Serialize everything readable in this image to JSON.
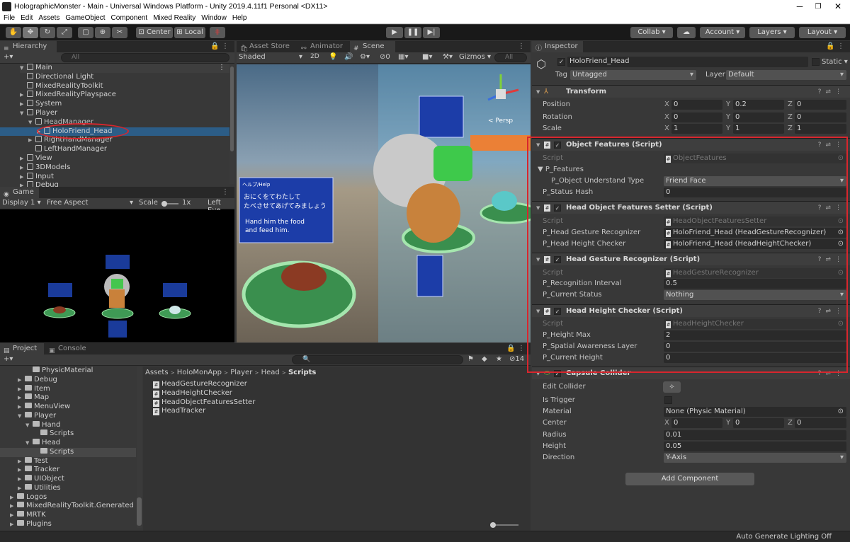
{
  "window": {
    "title": "HolographicMonster - Main - Universal Windows Platform - Unity 2019.4.11f1 Personal <DX11>"
  },
  "menu": [
    "File",
    "Edit",
    "Assets",
    "GameObject",
    "Component",
    "Mixed Reality",
    "Window",
    "Help"
  ],
  "toolbar": {
    "center_label": "Center",
    "local_label": "Local",
    "collab_label": "Collab ▾",
    "account_label": "Account",
    "layers_label": "Layers",
    "layout_label": "Layout"
  },
  "hierarchy": {
    "tab_label": "Hierarchy",
    "search_placeholder": "All",
    "scene_name": "Main",
    "items": [
      {
        "label": "Directional Light"
      },
      {
        "label": "MixedRealityToolkit"
      },
      {
        "label": "MixedRealityPlayspace"
      },
      {
        "label": "System"
      },
      {
        "label": "Player"
      },
      {
        "label": "HeadManager"
      },
      {
        "label": "HoloFriend_Head"
      },
      {
        "label": "RightHandManager"
      },
      {
        "label": "LeftHandManager"
      },
      {
        "label": "View"
      },
      {
        "label": "3DModels"
      },
      {
        "label": "Input"
      },
      {
        "label": "Debug"
      }
    ]
  },
  "game": {
    "tab_label": "Game",
    "display": "Display 1",
    "aspect": "Free Aspect",
    "scale_label": "Scale",
    "scale_value": "1x",
    "left_eye": "Left Eye"
  },
  "scene": {
    "tabs": [
      {
        "label": "Asset Store"
      },
      {
        "label": "Animator"
      },
      {
        "label": "Scene"
      }
    ],
    "shading": "Shaded",
    "mode_2d": "2D",
    "gizmos": "Gizmos",
    "search_placeholder": "All",
    "persp": "< Persp",
    "panel_title": "ヘルプ/Help",
    "panel_jp_1": "おにくをてわたして",
    "panel_jp_2": "たべさせてあげてみましょう",
    "panel_en_1": "Hand him the food",
    "panel_en_2": "and feed him."
  },
  "project": {
    "tabs": [
      {
        "label": "Project"
      },
      {
        "label": "Console"
      }
    ],
    "hidden_count": "14",
    "breadcrumb": [
      "Assets",
      "HoloMonApp",
      "Player",
      "Head",
      "Scripts"
    ],
    "tree": [
      {
        "label": "PhysicMaterial"
      },
      {
        "label": "Debug"
      },
      {
        "label": "Item"
      },
      {
        "label": "Map"
      },
      {
        "label": "MenuView"
      },
      {
        "label": "Player"
      },
      {
        "label": "Hand"
      },
      {
        "label": "Scripts"
      },
      {
        "label": "Head"
      },
      {
        "label": "Scripts"
      },
      {
        "label": "Test"
      },
      {
        "label": "Tracker"
      },
      {
        "label": "UIObject"
      },
      {
        "label": "Utilities"
      },
      {
        "label": "Logos"
      },
      {
        "label": "MixedRealityToolkit.Generated"
      },
      {
        "label": "MRTK"
      },
      {
        "label": "Plugins"
      }
    ],
    "files": [
      {
        "label": "HeadGestureRecognizer"
      },
      {
        "label": "HeadHeightChecker"
      },
      {
        "label": "HeadObjectFeaturesSetter"
      },
      {
        "label": "HeadTracker"
      }
    ]
  },
  "inspector": {
    "tab_label": "Inspector",
    "object_name": "HoloFriend_Head",
    "static_label": "Static",
    "tag_label": "Tag",
    "tag_value": "Untagged",
    "layer_label": "Layer",
    "layer_value": "Default",
    "transform": {
      "title": "Transform",
      "rows": [
        {
          "label": "Position",
          "x": "0",
          "y": "0.2",
          "z": "0"
        },
        {
          "label": "Rotation",
          "x": "0",
          "y": "0",
          "z": "0"
        },
        {
          "label": "Scale",
          "x": "1",
          "y": "1",
          "z": "1"
        }
      ]
    },
    "components": [
      {
        "title": "Object Features (Script)",
        "rows": [
          {
            "label": "Script",
            "value": "ObjectFeatures"
          },
          {
            "label": "P_Features",
            "value": ""
          },
          {
            "label": "P_Object Understand Type",
            "value": "Friend Face"
          },
          {
            "label": "P_Status Hash",
            "value": "0"
          }
        ]
      },
      {
        "title": "Head Object Features Setter (Script)",
        "rows": [
          {
            "label": "Script",
            "value": "HeadObjectFeaturesSetter"
          },
          {
            "label": "P_Head Gesture Recognizer",
            "value": "HoloFriend_Head (HeadGestureRecognizer)"
          },
          {
            "label": "P_Head Height Checker",
            "value": "HoloFriend_Head (HeadHeightChecker)"
          }
        ]
      },
      {
        "title": "Head Gesture Recognizer (Script)",
        "rows": [
          {
            "label": "Script",
            "value": "HeadGestureRecognizer"
          },
          {
            "label": "P_Recognition Interval",
            "value": "0.5"
          },
          {
            "label": "P_Current Status",
            "value": "Nothing"
          }
        ]
      },
      {
        "title": "Head Height Checker (Script)",
        "rows": [
          {
            "label": "Script",
            "value": "HeadHeightChecker"
          },
          {
            "label": "P_Height Max",
            "value": "2"
          },
          {
            "label": "P_Spatial Awareness Layer",
            "value": "0"
          },
          {
            "label": "P_Current Height",
            "value": "0"
          }
        ]
      }
    ],
    "collider": {
      "title": "Capsule Collider",
      "edit_label": "Edit Collider",
      "is_trigger_label": "Is Trigger",
      "material_label": "Material",
      "material_value": "None (Physic Material)",
      "center_label": "Center",
      "cx": "0",
      "cy": "0",
      "cz": "0",
      "radius_label": "Radius",
      "radius_value": "0.01",
      "height_label": "Height",
      "height_value": "0.05",
      "direction_label": "Direction",
      "direction_value": "Y-Axis"
    },
    "add_component": "Add Component"
  },
  "status_bar": {
    "text": "Auto Generate Lighting Off"
  },
  "colors": {
    "accent": "#2c5d87",
    "highlight": "#d8262d"
  }
}
